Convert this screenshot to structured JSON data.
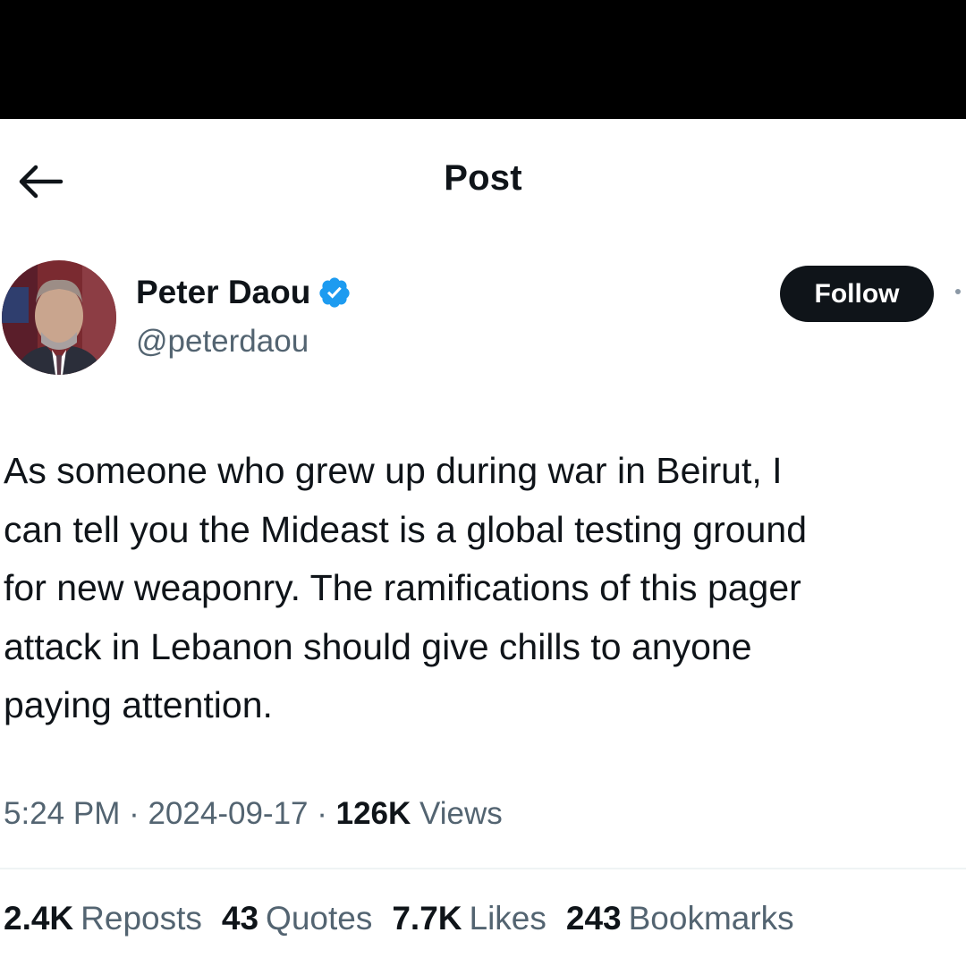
{
  "header": {
    "title": "Post",
    "back_icon": "arrow-left-icon"
  },
  "author": {
    "name": "Peter Daou",
    "handle": "@peterdaou",
    "verified_icon": "verified-badge-icon",
    "follow_label": "Follow"
  },
  "post": {
    "text": "As someone who grew up during war in Beirut, I\ncan tell you the Mideast is a global testing ground\nfor new weaponry. The ramifications of this pager\nattack in Lebanon should give chills to anyone\npaying attention.",
    "time": "5:24 PM",
    "separator": " · ",
    "date": "2024-09-17",
    "views_count": "126K",
    "views_label": " Views"
  },
  "stats": [
    {
      "count": "2.4K",
      "label": "Reposts"
    },
    {
      "count": "43",
      "label": "Quotes"
    },
    {
      "count": "7.7K",
      "label": "Likes"
    },
    {
      "count": "243",
      "label": "Bookmarks"
    }
  ],
  "colors": {
    "verified": "#1d9bf0",
    "follow_bg": "#0f1419",
    "secondary_text": "#536471"
  }
}
